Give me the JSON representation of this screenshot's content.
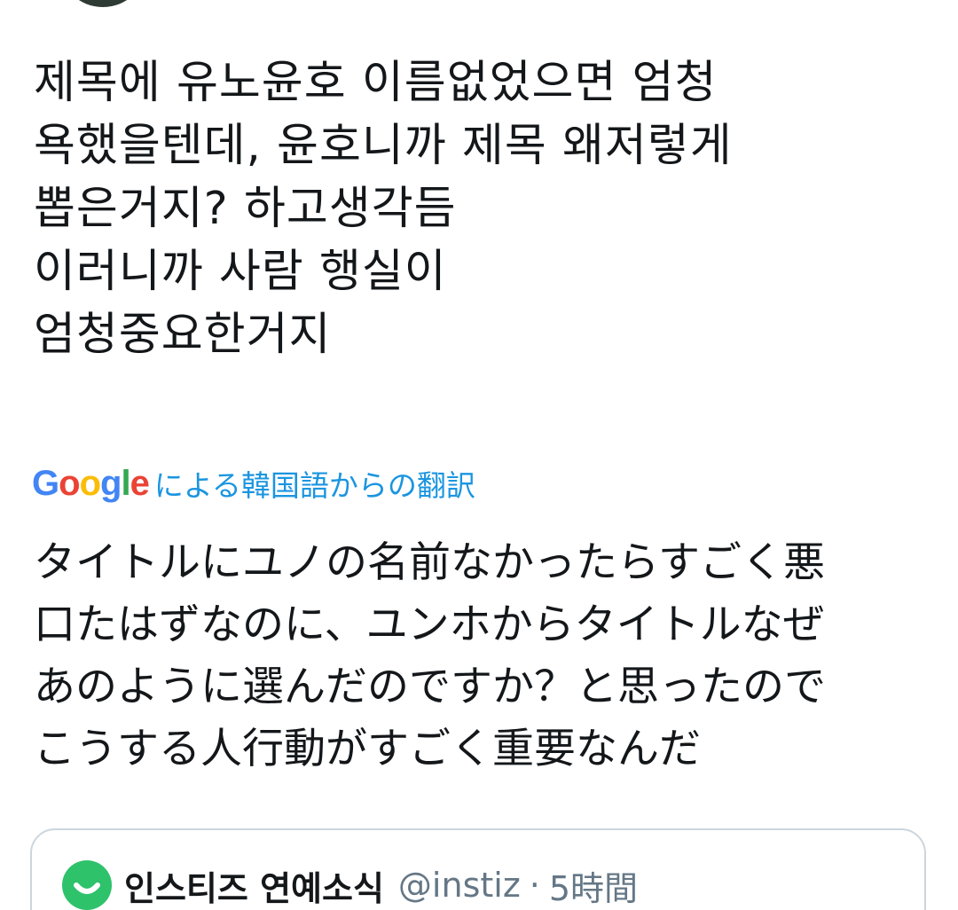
{
  "tweet": {
    "lines": [
      "제목에 유노윤호 이름없었으면 엄청",
      "욕했을텐데, 윤호니까 제목 왜저렇게",
      "뽑은거지? 하고생각듬",
      "이러니까 사람 행실이",
      "엄청중요한거지"
    ]
  },
  "translation": {
    "provider_logo": [
      "G",
      "o",
      "o",
      "g",
      "l",
      "e"
    ],
    "logo_colors": [
      "#4285f4",
      "#ea4335",
      "#fbbc05",
      "#4285f4",
      "#34a853",
      "#ea4335"
    ],
    "attribution": "による韓国語からの翻訳",
    "lines": [
      "タイトルにユノの名前なかったらすごく悪",
      "口たはずなのに、ユンホからタイトルなぜ",
      "あのように選んだのですか？と思ったので",
      "こうする人行動がすごく重要なんだ"
    ],
    "link_color": "#1b95e0"
  },
  "quote": {
    "name": "인스티즈 연예소식",
    "handle": "@instiz",
    "separator": "·",
    "time": "5時間",
    "avatar_icon": "smile-icon",
    "avatar_color": "#2ec26b"
  }
}
